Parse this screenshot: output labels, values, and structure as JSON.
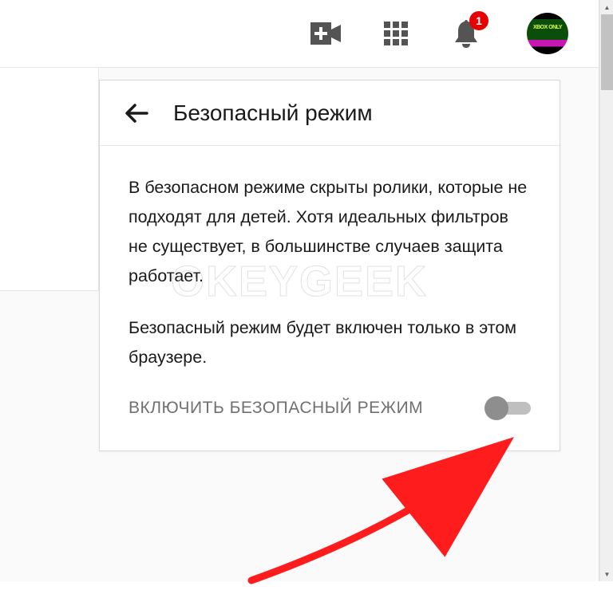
{
  "topbar": {
    "notification_count": "1",
    "avatar_text": "XBOX ONLY"
  },
  "panel": {
    "title": "Безопасный режим",
    "description_p1": "В безопасном режиме скрыты ролики, которые не подходят для детей. Хотя идеальных фильтров не существует, в большинстве случаев защита работает.",
    "description_p2": "Безопасный режим будет включен только в этом браузере.",
    "toggle_label": "ВКЛЮЧИТЬ БЕЗОПАСНЫЙ РЕЖИМ",
    "toggle_state": false
  },
  "watermark": "OKEYGEEK",
  "colors": {
    "badge": "#e60000",
    "text_primary": "#1a1a1a",
    "text_secondary": "#707070",
    "arrow_annotation": "#fe1c1c"
  }
}
